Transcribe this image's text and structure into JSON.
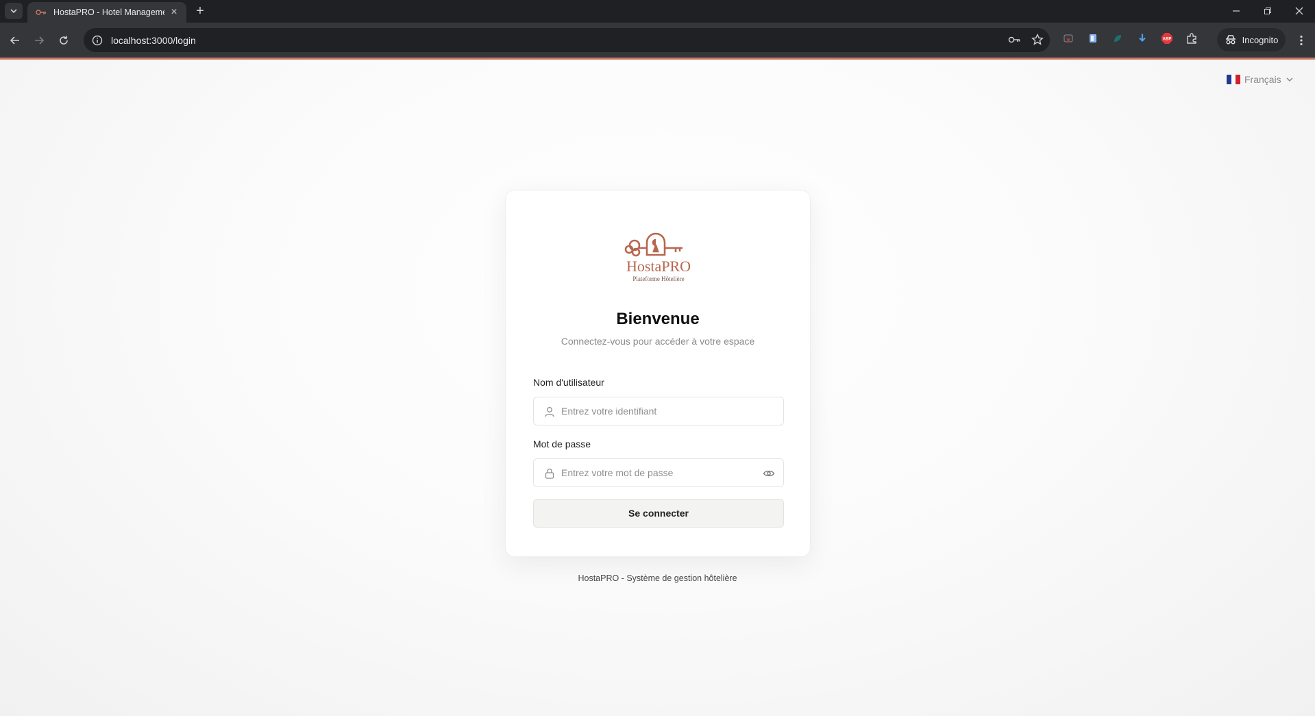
{
  "browser": {
    "tab_title": "HostaPRO - Hotel Management",
    "url": "localhost:3000/login",
    "incognito_label": "Incognito",
    "extension_abp_label": "ABP"
  },
  "language": {
    "label": "Français"
  },
  "brand": {
    "name": "HostaPRO",
    "tagline": "Plateforme Hôtelière",
    "color": "#b8664d"
  },
  "login": {
    "title": "Bienvenue",
    "subtitle": "Connectez-vous pour accéder à votre espace",
    "username_label": "Nom d'utilisateur",
    "username_placeholder": "Entrez votre identifiant",
    "password_label": "Mot de passe",
    "password_placeholder": "Entrez votre mot de passe",
    "submit_label": "Se connecter"
  },
  "footer": {
    "text": "HostaPRO - Système de gestion hôtelière"
  }
}
